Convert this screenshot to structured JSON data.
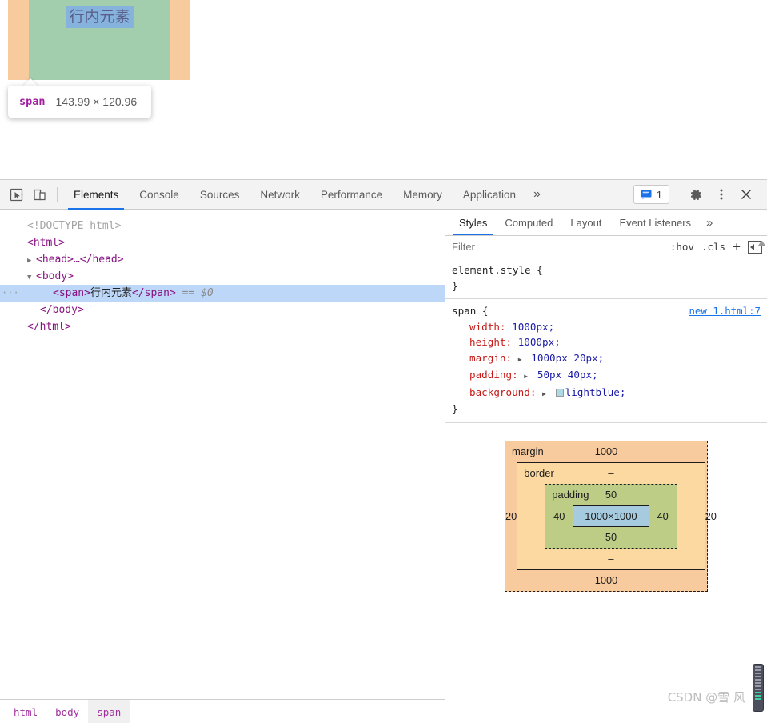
{
  "page": {
    "highlighted_text": "行内元素",
    "tooltip": {
      "tag": "span",
      "dimensions": "143.99 × 120.96"
    },
    "overlay_colors": {
      "margin": "#f7cb9d",
      "padding": "#a2ceae",
      "content": "#86b3dd"
    }
  },
  "devtools": {
    "toolbar": {
      "inspect_icon": "inspect-cursor-icon",
      "device_icon": "device-toolbar-icon",
      "tabs": [
        {
          "label": "Elements",
          "active": true
        },
        {
          "label": "Console",
          "active": false
        },
        {
          "label": "Sources",
          "active": false
        },
        {
          "label": "Network",
          "active": false
        },
        {
          "label": "Performance",
          "active": false
        },
        {
          "label": "Memory",
          "active": false
        },
        {
          "label": "Application",
          "active": false
        }
      ],
      "more_tabs": "»",
      "issues_count": "1",
      "settings_icon": "gear-icon",
      "more_icon": "kebab-menu-icon",
      "close_icon": "close-icon"
    },
    "dom": {
      "doctype": "<!DOCTYPE html>",
      "html_open": "<html>",
      "head_collapsed": "<head>…</head>",
      "body_open": "<body>",
      "span_open": "<span>",
      "span_text": "行内元素",
      "span_close": "</span>",
      "selected_marker": "== $0",
      "body_close": "</body>",
      "html_close": "</html>"
    },
    "breadcrumbs": [
      {
        "label": "html",
        "active": false
      },
      {
        "label": "body",
        "active": false
      },
      {
        "label": "span",
        "active": true
      }
    ],
    "styles": {
      "tabs": [
        {
          "label": "Styles",
          "active": true
        },
        {
          "label": "Computed",
          "active": false
        },
        {
          "label": "Layout",
          "active": false
        },
        {
          "label": "Event Listeners",
          "active": false
        }
      ],
      "more_tabs": "»",
      "filter_placeholder": "Filter",
      "hov_label": ":hov",
      "cls_label": ".cls",
      "plus_label": "+",
      "sidebar_toggle": "toggle-sidebar-icon",
      "rules": [
        {
          "selector": "element.style {",
          "source": "",
          "closing": "}",
          "declarations": []
        },
        {
          "selector": "span {",
          "source": "new 1.html:7",
          "closing": "}",
          "declarations": [
            {
              "name": "width",
              "value": "1000px;",
              "expandable": false,
              "swatch": null
            },
            {
              "name": "height",
              "value": "1000px;",
              "expandable": false,
              "swatch": null
            },
            {
              "name": "margin",
              "value": "1000px 20px;",
              "expandable": true,
              "swatch": null
            },
            {
              "name": "padding",
              "value": "50px 40px;",
              "expandable": true,
              "swatch": null
            },
            {
              "name": "background",
              "value": "lightblue;",
              "expandable": true,
              "swatch": "#add8e6"
            }
          ]
        }
      ],
      "box_model": {
        "margin_label": "margin",
        "margin_top": "1000",
        "margin_right": "20",
        "margin_bottom": "1000",
        "margin_left": "20",
        "border_label": "border",
        "border_top": "–",
        "border_right": "–",
        "border_bottom": "–",
        "border_left": "–",
        "padding_label": "padding",
        "padding_top": "50",
        "padding_right": "40",
        "padding_bottom": "50",
        "padding_left": "40",
        "content_size": "1000×1000",
        "colors": {
          "margin": "#f7cb9d",
          "border": "#fbd9a0",
          "padding": "#bdcd86",
          "content": "#a6cbdf"
        }
      }
    }
  },
  "watermark": "CSDN @雪 风"
}
